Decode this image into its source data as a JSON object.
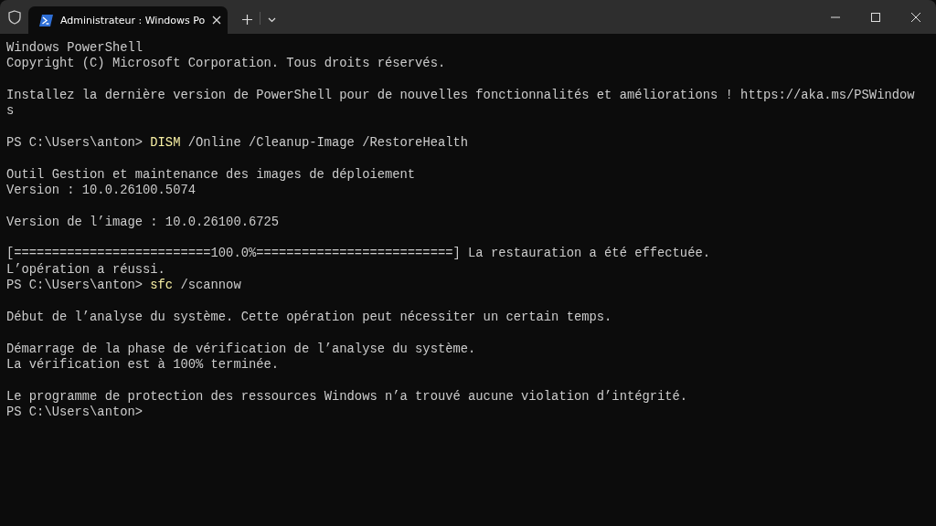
{
  "window": {
    "tab": {
      "title": "Administrateur : Windows Po",
      "selected": true
    }
  },
  "terminal": {
    "lines": [
      {
        "kind": "output",
        "text": "Windows PowerShell"
      },
      {
        "kind": "output",
        "text": "Copyright (C) Microsoft Corporation. Tous droits réservés."
      },
      {
        "kind": "blank"
      },
      {
        "kind": "output",
        "text": "Installez la dernière version de PowerShell pour de nouvelles fonctionnalités et améliorations ! https://aka.ms/PSWindow"
      },
      {
        "kind": "output",
        "text": "s"
      },
      {
        "kind": "blank"
      },
      {
        "kind": "prompt",
        "prompt": "PS C:\\Users\\anton>",
        "command": "DISM",
        "args": "/Online /Cleanup-Image /RestoreHealth"
      },
      {
        "kind": "blank"
      },
      {
        "kind": "output",
        "text": "Outil Gestion et maintenance des images de déploiement"
      },
      {
        "kind": "output",
        "text": "Version : 10.0.26100.5074"
      },
      {
        "kind": "blank"
      },
      {
        "kind": "output",
        "text": "Version de l’image : 10.0.26100.6725"
      },
      {
        "kind": "blank"
      },
      {
        "kind": "output",
        "text": "[==========================100.0%==========================] La restauration a été effectuée."
      },
      {
        "kind": "output",
        "text": "L’opération a réussi."
      },
      {
        "kind": "prompt",
        "prompt": "PS C:\\Users\\anton>",
        "command": "sfc",
        "args": "/scannow"
      },
      {
        "kind": "blank"
      },
      {
        "kind": "output",
        "text": "Début de l’analyse du système. Cette opération peut nécessiter un certain temps."
      },
      {
        "kind": "blank"
      },
      {
        "kind": "output",
        "text": "Démarrage de la phase de vérification de l’analyse du système."
      },
      {
        "kind": "output",
        "text": "La vérification est à 100% terminée."
      },
      {
        "kind": "blank"
      },
      {
        "kind": "output",
        "text": "Le programme de protection des ressources Windows n’a trouvé aucune violation d’intégrité."
      },
      {
        "kind": "prompt",
        "prompt": "PS C:\\Users\\anton>"
      }
    ]
  }
}
